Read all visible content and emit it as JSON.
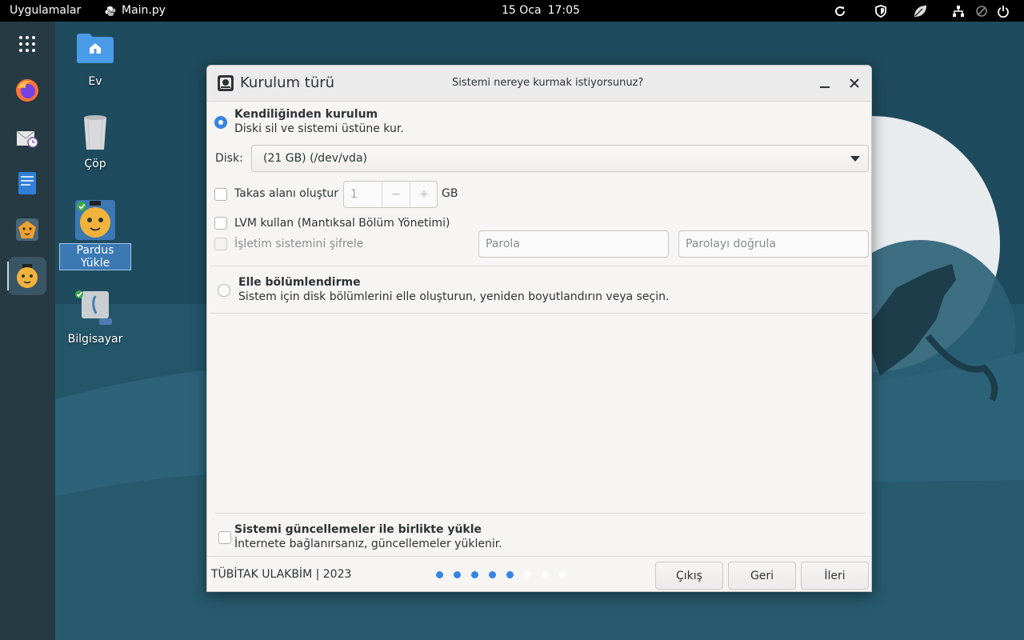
{
  "topbar": {
    "apps_menu": "Uygulamalar",
    "active_app": "Main.py",
    "date": "15 Oca",
    "time": "17:05"
  },
  "desktop_icons": [
    {
      "label": "Ev",
      "icon": "home-folder-icon"
    },
    {
      "label": "Çöp",
      "icon": "trash-icon"
    },
    {
      "label": "Pardus Yükle",
      "icon": "pardus-installer-icon",
      "selected": true
    },
    {
      "label": "Bilgisayar",
      "icon": "computer-icon"
    }
  ],
  "dock": [
    "app-grid-icon",
    "firefox-icon",
    "mail-clock-icon",
    "text-editor-icon",
    "lion-app-icon",
    "pardus-installer-icon"
  ],
  "dialog": {
    "title": "Kurulum türü",
    "subtitle": "Sistemi nereye kurmak istiyorsunuz?",
    "auto": {
      "title": "Kendiliğinden kurulum",
      "desc": "Diski sil ve sistemi üstüne kur.",
      "selected": true
    },
    "disk": {
      "label": "Disk:",
      "value": "(21 GB) (/dev/vda)"
    },
    "swap": {
      "label": "Takas alanı oluştur",
      "value": "1",
      "minus": "−",
      "plus": "+",
      "unit": "GB"
    },
    "lvm": {
      "label": "LVM kullan (Mantıksal Bölüm Yönetimi)"
    },
    "encrypt": {
      "label": "İşletim sistemini şifrele",
      "password_placeholder": "Parola",
      "confirm_placeholder": "Parolayı doğrula"
    },
    "manual": {
      "title": "Elle bölümlendirme",
      "desc": "Sistem için disk bölümlerini elle oluşturun, yeniden boyutlandırın veya seçin."
    },
    "updates": {
      "title": "Sistemi güncellemeler ile birlikte yükle",
      "desc": "İnternete bağlanırsanız, güncellemeler yüklenir."
    },
    "footer": {
      "credit": "TÜBİTAK ULAKBİM | 2023",
      "progress": {
        "total_steps": 8,
        "completed_steps": 5
      },
      "quit": "Çıkış",
      "back": "Geri",
      "next": "İleri"
    }
  },
  "colors": {
    "accent": "#3584e4",
    "topbar": "#000000",
    "dock": "#263a44",
    "wallpaper": "#1f4a5c"
  }
}
